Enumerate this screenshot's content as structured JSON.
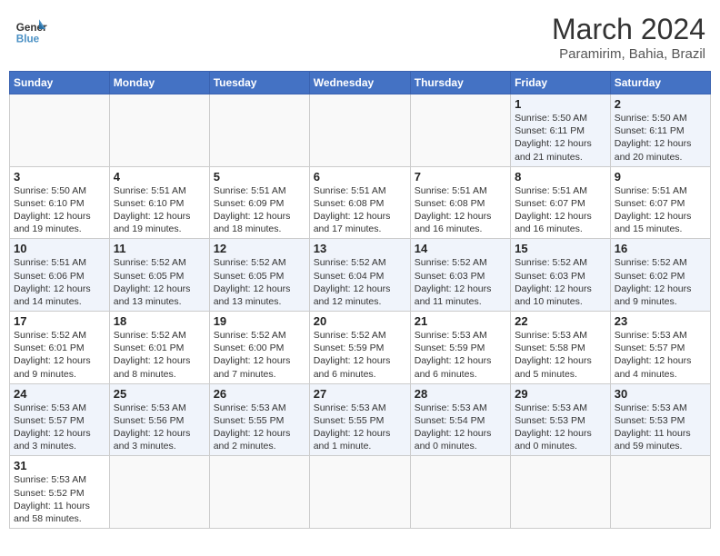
{
  "header": {
    "logo_general": "General",
    "logo_blue": "Blue",
    "month_year": "March 2024",
    "location": "Paramirim, Bahia, Brazil"
  },
  "weekdays": [
    "Sunday",
    "Monday",
    "Tuesday",
    "Wednesday",
    "Thursday",
    "Friday",
    "Saturday"
  ],
  "weeks": [
    [
      {
        "day": "",
        "info": ""
      },
      {
        "day": "",
        "info": ""
      },
      {
        "day": "",
        "info": ""
      },
      {
        "day": "",
        "info": ""
      },
      {
        "day": "",
        "info": ""
      },
      {
        "day": "1",
        "info": "Sunrise: 5:50 AM\nSunset: 6:11 PM\nDaylight: 12 hours\nand 21 minutes."
      },
      {
        "day": "2",
        "info": "Sunrise: 5:50 AM\nSunset: 6:11 PM\nDaylight: 12 hours\nand 20 minutes."
      }
    ],
    [
      {
        "day": "3",
        "info": "Sunrise: 5:50 AM\nSunset: 6:10 PM\nDaylight: 12 hours\nand 19 minutes."
      },
      {
        "day": "4",
        "info": "Sunrise: 5:51 AM\nSunset: 6:10 PM\nDaylight: 12 hours\nand 19 minutes."
      },
      {
        "day": "5",
        "info": "Sunrise: 5:51 AM\nSunset: 6:09 PM\nDaylight: 12 hours\nand 18 minutes."
      },
      {
        "day": "6",
        "info": "Sunrise: 5:51 AM\nSunset: 6:08 PM\nDaylight: 12 hours\nand 17 minutes."
      },
      {
        "day": "7",
        "info": "Sunrise: 5:51 AM\nSunset: 6:08 PM\nDaylight: 12 hours\nand 16 minutes."
      },
      {
        "day": "8",
        "info": "Sunrise: 5:51 AM\nSunset: 6:07 PM\nDaylight: 12 hours\nand 16 minutes."
      },
      {
        "day": "9",
        "info": "Sunrise: 5:51 AM\nSunset: 6:07 PM\nDaylight: 12 hours\nand 15 minutes."
      }
    ],
    [
      {
        "day": "10",
        "info": "Sunrise: 5:51 AM\nSunset: 6:06 PM\nDaylight: 12 hours\nand 14 minutes."
      },
      {
        "day": "11",
        "info": "Sunrise: 5:52 AM\nSunset: 6:05 PM\nDaylight: 12 hours\nand 13 minutes."
      },
      {
        "day": "12",
        "info": "Sunrise: 5:52 AM\nSunset: 6:05 PM\nDaylight: 12 hours\nand 13 minutes."
      },
      {
        "day": "13",
        "info": "Sunrise: 5:52 AM\nSunset: 6:04 PM\nDaylight: 12 hours\nand 12 minutes."
      },
      {
        "day": "14",
        "info": "Sunrise: 5:52 AM\nSunset: 6:03 PM\nDaylight: 12 hours\nand 11 minutes."
      },
      {
        "day": "15",
        "info": "Sunrise: 5:52 AM\nSunset: 6:03 PM\nDaylight: 12 hours\nand 10 minutes."
      },
      {
        "day": "16",
        "info": "Sunrise: 5:52 AM\nSunset: 6:02 PM\nDaylight: 12 hours\nand 9 minutes."
      }
    ],
    [
      {
        "day": "17",
        "info": "Sunrise: 5:52 AM\nSunset: 6:01 PM\nDaylight: 12 hours\nand 9 minutes."
      },
      {
        "day": "18",
        "info": "Sunrise: 5:52 AM\nSunset: 6:01 PM\nDaylight: 12 hours\nand 8 minutes."
      },
      {
        "day": "19",
        "info": "Sunrise: 5:52 AM\nSunset: 6:00 PM\nDaylight: 12 hours\nand 7 minutes."
      },
      {
        "day": "20",
        "info": "Sunrise: 5:52 AM\nSunset: 5:59 PM\nDaylight: 12 hours\nand 6 minutes."
      },
      {
        "day": "21",
        "info": "Sunrise: 5:53 AM\nSunset: 5:59 PM\nDaylight: 12 hours\nand 6 minutes."
      },
      {
        "day": "22",
        "info": "Sunrise: 5:53 AM\nSunset: 5:58 PM\nDaylight: 12 hours\nand 5 minutes."
      },
      {
        "day": "23",
        "info": "Sunrise: 5:53 AM\nSunset: 5:57 PM\nDaylight: 12 hours\nand 4 minutes."
      }
    ],
    [
      {
        "day": "24",
        "info": "Sunrise: 5:53 AM\nSunset: 5:57 PM\nDaylight: 12 hours\nand 3 minutes."
      },
      {
        "day": "25",
        "info": "Sunrise: 5:53 AM\nSunset: 5:56 PM\nDaylight: 12 hours\nand 3 minutes."
      },
      {
        "day": "26",
        "info": "Sunrise: 5:53 AM\nSunset: 5:55 PM\nDaylight: 12 hours\nand 2 minutes."
      },
      {
        "day": "27",
        "info": "Sunrise: 5:53 AM\nSunset: 5:55 PM\nDaylight: 12 hours\nand 1 minute."
      },
      {
        "day": "28",
        "info": "Sunrise: 5:53 AM\nSunset: 5:54 PM\nDaylight: 12 hours\nand 0 minutes."
      },
      {
        "day": "29",
        "info": "Sunrise: 5:53 AM\nSunset: 5:53 PM\nDaylight: 12 hours\nand 0 minutes."
      },
      {
        "day": "30",
        "info": "Sunrise: 5:53 AM\nSunset: 5:53 PM\nDaylight: 11 hours\nand 59 minutes."
      }
    ],
    [
      {
        "day": "31",
        "info": "Sunrise: 5:53 AM\nSunset: 5:52 PM\nDaylight: 11 hours\nand 58 minutes."
      },
      {
        "day": "",
        "info": ""
      },
      {
        "day": "",
        "info": ""
      },
      {
        "day": "",
        "info": ""
      },
      {
        "day": "",
        "info": ""
      },
      {
        "day": "",
        "info": ""
      },
      {
        "day": "",
        "info": ""
      }
    ]
  ]
}
